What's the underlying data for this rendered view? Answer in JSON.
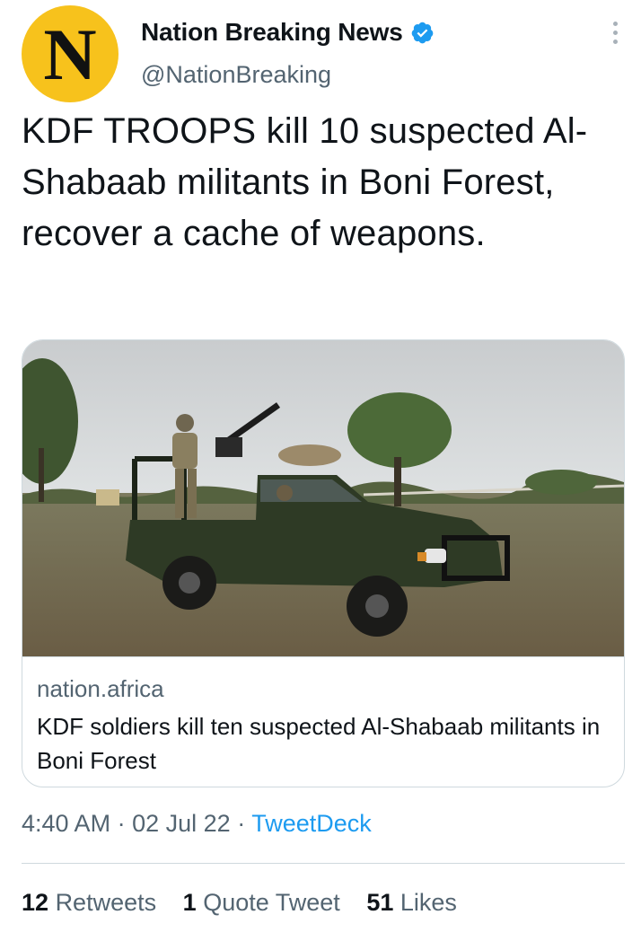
{
  "account": {
    "avatar_letter": "N",
    "avatar_color": "#f7c21c",
    "name": "Nation Breaking News",
    "handle": "@NationBreaking",
    "verified_icon": "verified-badge-icon"
  },
  "tweet": {
    "text": "KDF TROOPS kill 10 suspected Al-Shabaab militants in Boni Forest, recover a cache of weapons."
  },
  "card": {
    "image_alt": "Military pickup truck with mounted gun and soldiers in a forest clearing",
    "domain": "nation.africa",
    "title": "KDF soldiers kill ten suspected Al-Shabaab militants in Boni Forest"
  },
  "meta": {
    "time": "4:40 AM",
    "sep1": "·",
    "date": "02 Jul 22",
    "sep2": "·",
    "source": "TweetDeck"
  },
  "stats": {
    "retweets_count": "12",
    "retweets_label": "Retweets",
    "quotes_count": "1",
    "quotes_label": "Quote Tweet",
    "likes_count": "51",
    "likes_label": "Likes"
  },
  "colors": {
    "link": "#1d9bf0",
    "secondary_text": "#536471",
    "border": "#cfd9de"
  }
}
